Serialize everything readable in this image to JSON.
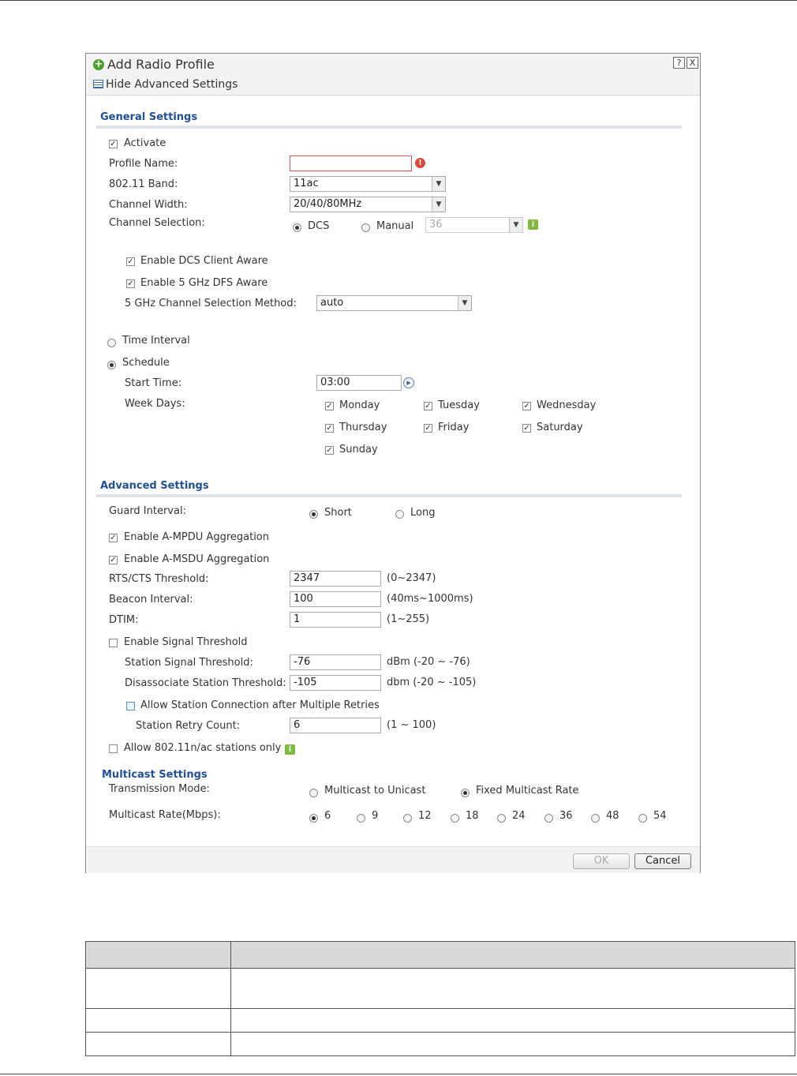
{
  "dialog": {
    "title": "Add Radio Profile",
    "help_symbol": "?",
    "close_symbol": "X",
    "hide_advanced_label": "Hide Advanced Settings"
  },
  "general": {
    "section_title": "General Settings",
    "activate_label": "Activate",
    "activate_checked": true,
    "profile_name_label": "Profile Name:",
    "profile_name_value": "",
    "band_label": "802.11 Band:",
    "band_value": "11ac",
    "channel_width_label": "Channel Width:",
    "channel_width_value": "20/40/80MHz",
    "channel_selection_label": "Channel Selection:",
    "dcs_label": "DCS",
    "manual_label": "Manual",
    "manual_channel_value": "36",
    "dcs_client_aware_label": "Enable DCS Client Aware",
    "dfs_aware_label": "Enable 5 GHz DFS Aware",
    "method_label": "5 GHz Channel Selection Method:",
    "method_value": "auto",
    "time_interval_label": "Time Interval",
    "schedule_label": "Schedule",
    "start_time_label": "Start Time:",
    "start_time_value": "03:00",
    "week_days_label": "Week Days:",
    "days": [
      "Monday",
      "Tuesday",
      "Wednesday",
      "Thursday",
      "Friday",
      "Saturday",
      "Sunday"
    ]
  },
  "advanced": {
    "section_title": "Advanced Settings",
    "guard_interval_label": "Guard Interval:",
    "short_label": "Short",
    "long_label": "Long",
    "ampdu_label": "Enable A-MPDU Aggregation",
    "amsdu_label": "Enable A-MSDU Aggregation",
    "rts_label": "RTS/CTS Threshold:",
    "rts_value": "2347",
    "rts_range": "(0~2347)",
    "beacon_label": "Beacon Interval:",
    "beacon_value": "100",
    "beacon_range": "(40ms~1000ms)",
    "dtim_label": "DTIM:",
    "dtim_value": "1",
    "dtim_range": "(1~255)",
    "signal_threshold_label": "Enable Signal Threshold",
    "station_signal_label": "Station Signal Threshold:",
    "station_signal_value": "-76",
    "station_signal_range": "dBm (-20 ~ -76)",
    "disassoc_label": "Disassociate Station Threshold:",
    "disassoc_value": "-105",
    "disassoc_range": "dbm (-20 ~ -105)",
    "allow_retries_label": "Allow Station Connection after Multiple Retries",
    "retry_count_label": "Station Retry Count:",
    "retry_count_value": "6",
    "retry_count_range": "(1 ~ 100)",
    "n_ac_only_label": "Allow 802.11n/ac stations only"
  },
  "multicast": {
    "section_title": "Multicast Settings",
    "transmission_label": "Transmission Mode:",
    "to_unicast_label": "Multicast to Unicast",
    "fixed_rate_label": "Fixed Multicast Rate",
    "rate_label": "Multicast Rate(Mbps):",
    "rates": [
      "6",
      "9",
      "12",
      "18",
      "24",
      "36",
      "48",
      "54"
    ],
    "selected_rate": "6"
  },
  "footer": {
    "ok_label": "OK",
    "cancel_label": "Cancel"
  },
  "colors": {
    "section_title": "#1f4f9a",
    "error": "#d94a3a",
    "info": "#7db93a"
  }
}
